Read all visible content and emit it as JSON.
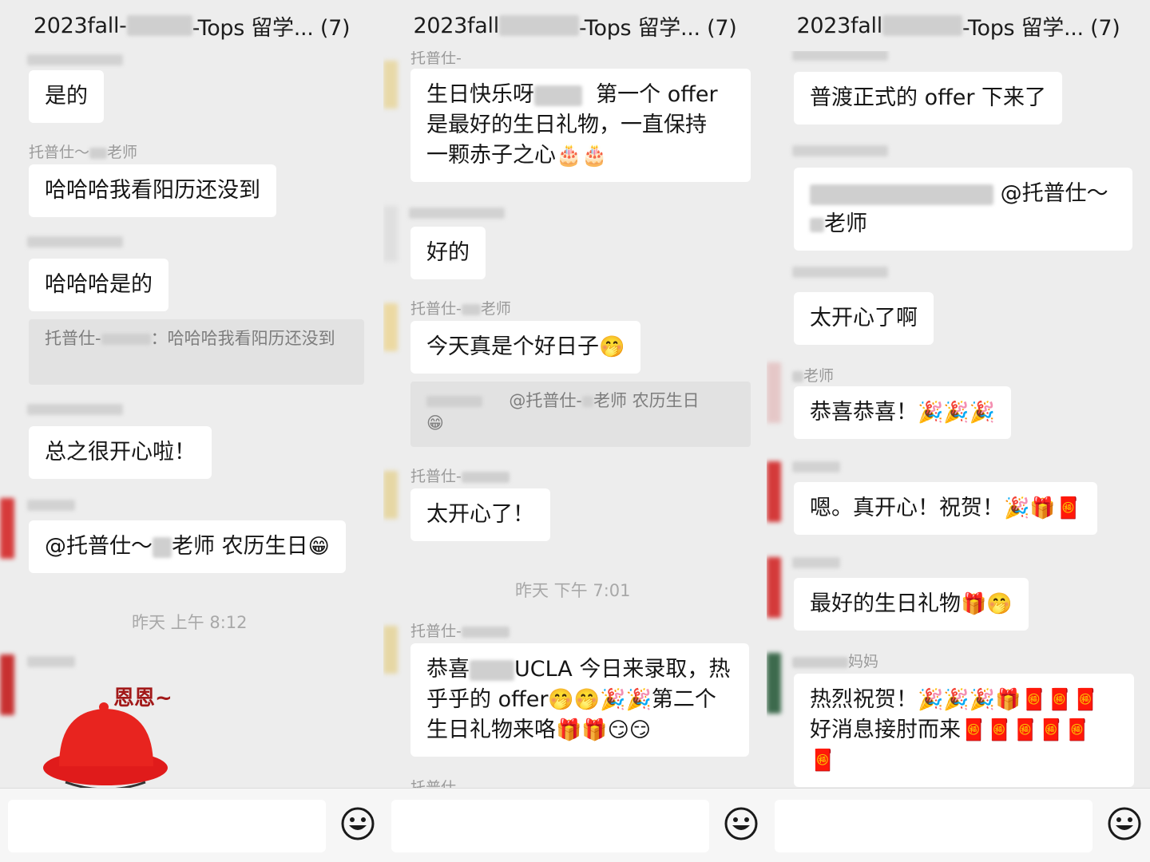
{
  "panels": [
    {
      "title_prefix": "2023fall-",
      "title_suffix": "-Tops 留学... (7)",
      "messages": {
        "m1": "是的",
        "s2": "托普仕～",
        "s2b": "老师",
        "m2": "哈哈哈我看阳历还没到",
        "m3": "哈哈哈是的",
        "q3": "托普仕-",
        "q3b": "：哈哈哈我看阳历还没到",
        "m4": "总之很开心啦！",
        "m5": "@托普仕～",
        "m5b": "老师 农历生日",
        "ts": "昨天 上午 8:12",
        "sticker": "恩恩~"
      }
    },
    {
      "title_prefix": "2023fall",
      "title_suffix": "-Tops 留学... (7)",
      "messages": {
        "s0": "托普仕-",
        "m1a": "生日快乐呀",
        "m1b": "第一个 offer",
        "m1c": "是最好的生日礼物，一直保持",
        "m1d": "一颗赤子之心",
        "m2": "好的",
        "s3": "托普仕-",
        "s3b": "老师",
        "m3": "今天真是个好日子",
        "q3": "@托普仕-",
        "q3b": "老师 农历生日",
        "s4": "托普仕-",
        "m4": "太开心了！",
        "ts": "昨天 下午 7:01",
        "s5": "托普仕-",
        "m5a": "恭喜",
        "m5b": "UCLA 今日来录取，热",
        "m5c": "乎乎的 offer",
        "m5d": "第二个",
        "m5e": "生日礼物来咯",
        "s6": "托普仕-"
      }
    },
    {
      "title_prefix": "2023fall",
      "title_suffix": "-Tops 留学... (7)",
      "messages": {
        "m1": "普渡正式的 offer 下来了",
        "m2a": "@托普仕～",
        "m2b": "老师",
        "m3": "太开心了啊",
        "s4": "老师",
        "m4": "恭喜恭喜！",
        "m5": "嗯。真开心！祝贺！",
        "m6": "最好的生日礼物",
        "s7": "妈妈",
        "m7a": "热烈祝贺！",
        "m7b": "好消息接肘而来"
      }
    }
  ]
}
